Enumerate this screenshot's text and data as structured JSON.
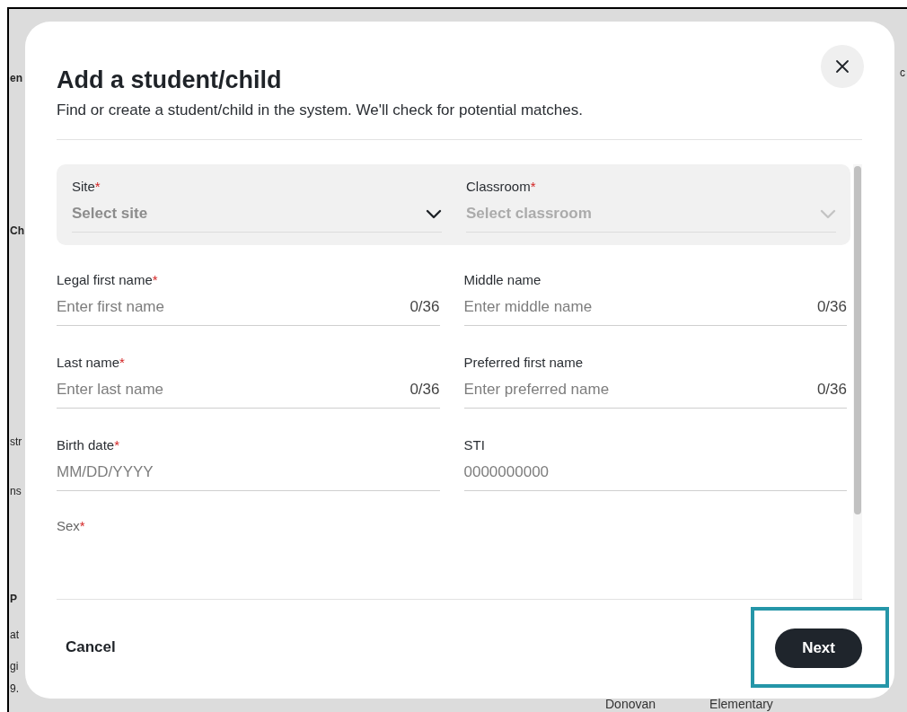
{
  "background": {
    "left_fragments": [
      {
        "text": "en",
        "bold": true
      },
      {
        "text": "Ch",
        "bold": true
      },
      {
        "text": "str",
        "bold": false
      },
      {
        "text": "ns",
        "bold": false
      },
      {
        "text": "P",
        "bold": true
      },
      {
        "text": "at",
        "bold": false
      },
      {
        "text": "gi",
        "bold": false
      },
      {
        "text": "9.",
        "bold": false
      }
    ],
    "right_fragment": "c",
    "bottom_cells": [
      "Donovan",
      "Elementary"
    ]
  },
  "dialog": {
    "title": "Add a student/child",
    "subtitle": "Find or create a student/child in the system. We'll check for potential matches.",
    "selects": [
      {
        "label": "Site",
        "required_mark": "*",
        "placeholder": "Select site",
        "disabled": false
      },
      {
        "label": "Classroom",
        "required_mark": "*",
        "placeholder": "Select classroom",
        "disabled": true
      }
    ],
    "fields": [
      {
        "label": "Legal first name",
        "required_mark": "*",
        "placeholder": "Enter first name",
        "counter": "0/36"
      },
      {
        "label": "Middle name",
        "placeholder": "Enter middle name",
        "counter": "0/36"
      },
      {
        "label": "Last name",
        "required_mark": "*",
        "placeholder": "Enter last name",
        "counter": "0/36"
      },
      {
        "label": "Preferred first name",
        "placeholder": "Enter preferred name",
        "counter": "0/36"
      },
      {
        "label": "Birth date",
        "required_mark": "*",
        "placeholder": "MM/DD/YYYY"
      },
      {
        "label": "STI",
        "placeholder": "0000000000"
      }
    ],
    "partial_field": {
      "label": "Sex",
      "required_mark": "*"
    },
    "footer": {
      "cancel": "Cancel",
      "next": "Next",
      "next_highlighted": true
    }
  }
}
